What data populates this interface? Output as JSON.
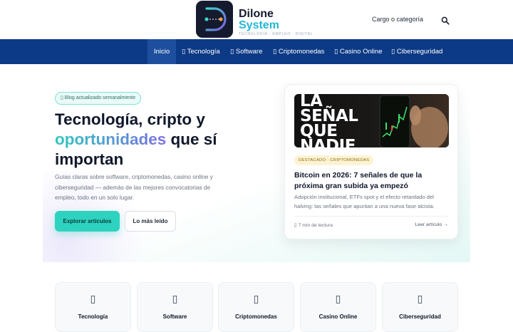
{
  "brand": {
    "name_line1": "Dilone",
    "name_line2": "System",
    "tagline": "TECNOLOGÍA · EMPLEO · DIGITAL"
  },
  "header": {
    "category_link": "Cargo o categoría",
    "search_icon": "search-icon"
  },
  "nav": {
    "items": [
      {
        "label": "Inicio"
      },
      {
        "label": "▯ Tecnología"
      },
      {
        "label": "▯ Software"
      },
      {
        "label": "▯ Criptomonedas"
      },
      {
        "label": "▯ Casino Online"
      },
      {
        "label": "▯ Ciberseguridad"
      }
    ],
    "active_index": 0
  },
  "hero": {
    "badge": "▯ Blog actualizado semanalmente",
    "title_part1": "Tecnología, cripto y",
    "title_highlight": "oportunidades",
    "title_part2": " que sí importan",
    "subtitle": "Guías claras sobre software, criptomonedas, casino online y ciberseguridad — además de las mejores convocatorias de empleo, todo en un solo lugar.",
    "primary_button": "Explorar artículos",
    "secondary_button": "Lo más leído"
  },
  "featured": {
    "image_text": "LA SEÑAL QUE NADIE VIO",
    "tag": "DESTACADO · CRIPTOMONEDAS",
    "title": "Bitcoin en 2026: 7 señales de que la próxima gran subida ya empezó",
    "description": "Adopción institucional, ETFs spot y el efecto retardado del halving: las señales que apuntan a una nueva fase alcista.",
    "read_time": "▯ 7 min de lectura",
    "read_link": "Leer artículo →"
  },
  "categories": [
    {
      "label": "Tecnología",
      "icon": "▯"
    },
    {
      "label": "Software",
      "icon": "▯"
    },
    {
      "label": "Criptomonedas",
      "icon": "▯"
    },
    {
      "label": "Casino Online",
      "icon": "▯"
    },
    {
      "label": "Ciberseguridad",
      "icon": "▯"
    }
  ],
  "colors": {
    "nav_bg": "#0d3a86",
    "accent": "#2ed3c0",
    "brand_dark": "#161a2e"
  }
}
